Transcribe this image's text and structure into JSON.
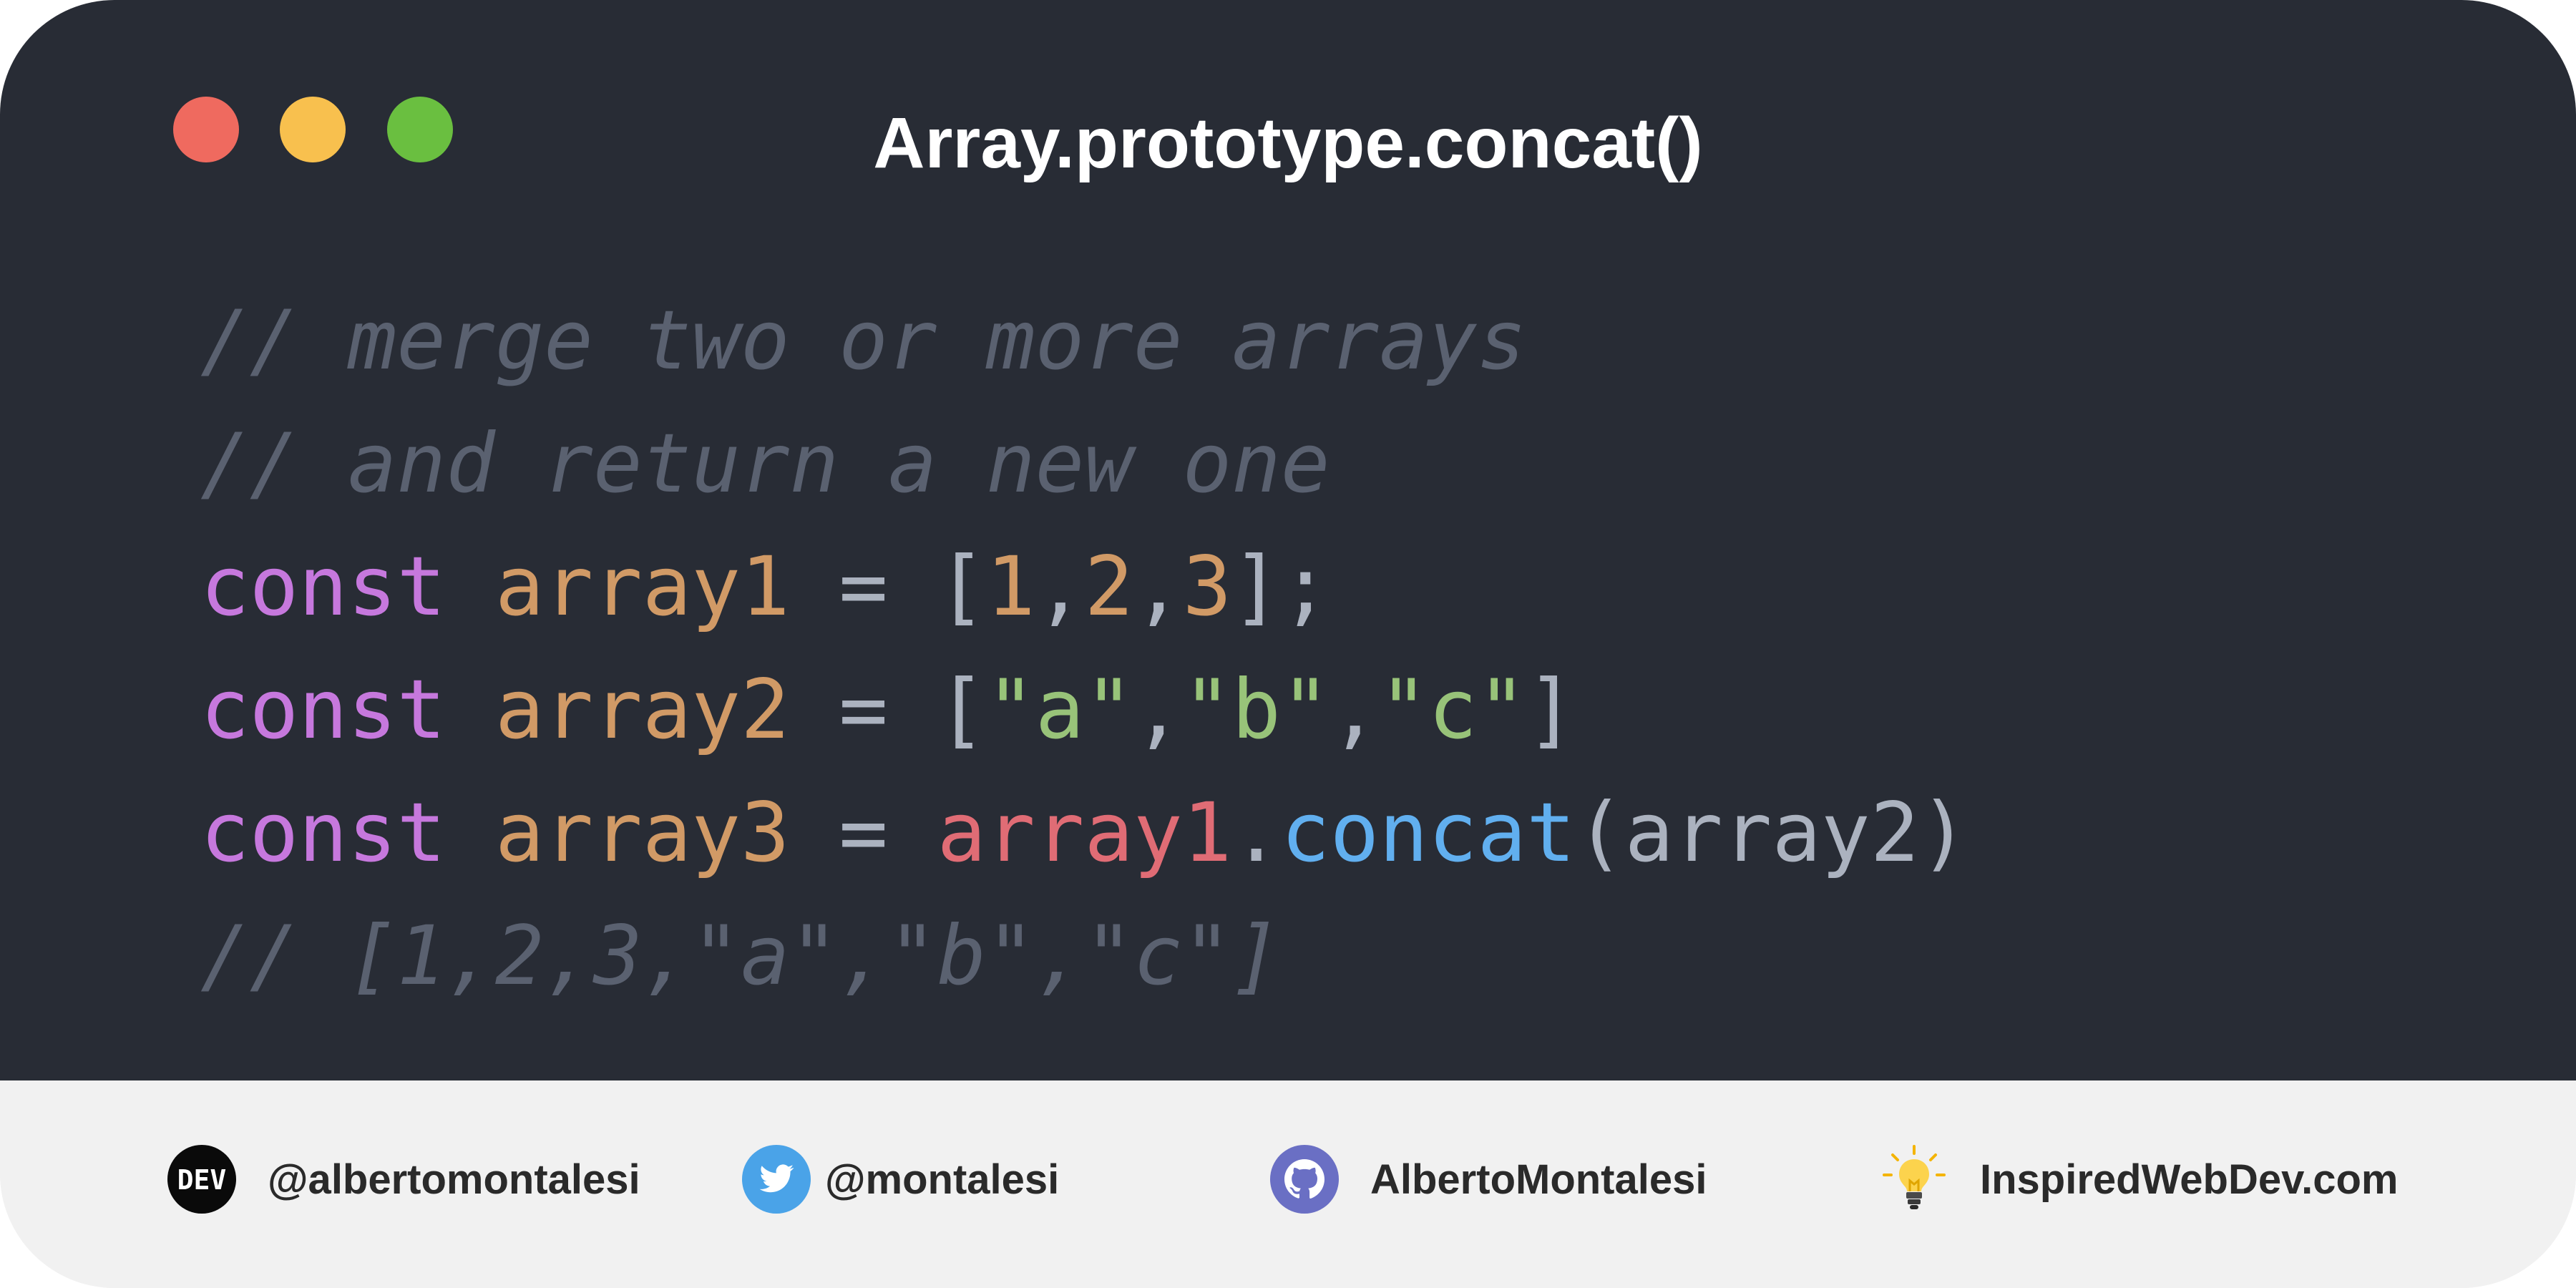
{
  "window": {
    "title": "Array.prototype.concat()",
    "controls": [
      "close",
      "minimize",
      "maximize"
    ]
  },
  "code": {
    "lines": [
      [
        {
          "cls": "comment",
          "text": "// merge two or more arrays"
        }
      ],
      [
        {
          "cls": "comment",
          "text": "// and return a new one"
        }
      ],
      [
        {
          "cls": "kw",
          "text": "const"
        },
        {
          "cls": "punc",
          "text": " "
        },
        {
          "cls": "var",
          "text": "array1"
        },
        {
          "cls": "punc",
          "text": " = ["
        },
        {
          "cls": "num",
          "text": "1"
        },
        {
          "cls": "punc",
          "text": ","
        },
        {
          "cls": "num",
          "text": "2"
        },
        {
          "cls": "punc",
          "text": ","
        },
        {
          "cls": "num",
          "text": "3"
        },
        {
          "cls": "punc",
          "text": "];"
        }
      ],
      [
        {
          "cls": "kw",
          "text": "const"
        },
        {
          "cls": "punc",
          "text": " "
        },
        {
          "cls": "var",
          "text": "array2"
        },
        {
          "cls": "punc",
          "text": " = ["
        },
        {
          "cls": "str",
          "text": "\"a\""
        },
        {
          "cls": "punc",
          "text": ","
        },
        {
          "cls": "str",
          "text": "\"b\""
        },
        {
          "cls": "punc",
          "text": ","
        },
        {
          "cls": "str",
          "text": "\"c\""
        },
        {
          "cls": "punc",
          "text": "]"
        }
      ],
      [
        {
          "cls": "kw",
          "text": "const"
        },
        {
          "cls": "punc",
          "text": " "
        },
        {
          "cls": "var",
          "text": "array3"
        },
        {
          "cls": "punc",
          "text": " = "
        },
        {
          "cls": "obj",
          "text": "array1"
        },
        {
          "cls": "punc",
          "text": "."
        },
        {
          "cls": "fn",
          "text": "concat"
        },
        {
          "cls": "punc",
          "text": "("
        },
        {
          "cls": "ident",
          "text": "array2"
        },
        {
          "cls": "punc",
          "text": ")"
        }
      ],
      [
        {
          "cls": "comment",
          "text": "// [1,2,3,\"a\",\"b\",\"c\"]"
        }
      ]
    ]
  },
  "footer": {
    "dev": {
      "handle": "@albertomontalesi",
      "icon": "dev-logo-icon"
    },
    "twitter": {
      "handle": "@montalesi",
      "icon": "twitter-bird-icon"
    },
    "github": {
      "handle": "AlbertoMontalesi",
      "icon": "github-octocat-icon"
    },
    "website": {
      "handle": "InspiredWebDev.com",
      "icon": "lightbulb-icon"
    }
  },
  "colors": {
    "panel_bg": "#282c35",
    "footer_bg": "#f1f1f1",
    "dot_red": "#ef6a5f",
    "dot_yellow": "#f8c04e",
    "dot_green": "#6abf40",
    "keyword": "#c678dd",
    "variable": "#d19a66",
    "string": "#98c379",
    "object": "#e06c75",
    "function": "#61afef",
    "comment": "#5a6170"
  }
}
